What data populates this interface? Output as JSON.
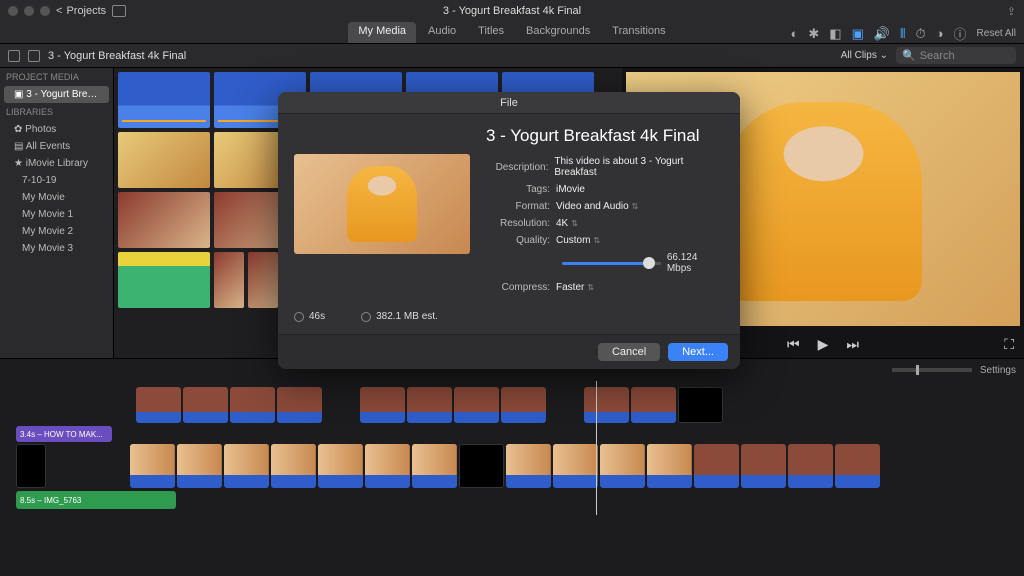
{
  "titlebar": {
    "projects": "Projects",
    "title": "3 - Yogurt Breakfast 4k Final"
  },
  "tabs": {
    "items": [
      "My Media",
      "Audio",
      "Titles",
      "Backgrounds",
      "Transitions"
    ],
    "reset": "Reset All"
  },
  "browserbar": {
    "title": "3 - Yogurt Breakfast 4k Final",
    "allclips": "All Clips",
    "search_placeholder": "Search"
  },
  "sidebar": {
    "hdr1": "Project Media",
    "project": "3 - Yogurt Breakfas...",
    "hdr2": "Libraries",
    "items": [
      "Photos",
      "All Events",
      "iMovie Library",
      "7-10-19",
      "My Movie",
      "My Movie 1",
      "My Movie 2",
      "My Movie 3"
    ]
  },
  "timeline_bar": {
    "settings": "Settings"
  },
  "timeline": {
    "title_clip": "3.4s – HOW TO MAK...",
    "audio_clip": "8.5s – IMG_5763"
  },
  "dialog": {
    "header": "File",
    "title": "3 - Yogurt Breakfast 4k Final",
    "rows": {
      "description": {
        "label": "Description:",
        "value": "This video is about 3 - Yogurt Breakfast"
      },
      "tags": {
        "label": "Tags:",
        "value": "iMovie"
      },
      "format": {
        "label": "Format:",
        "value": "Video and Audio"
      },
      "resolution": {
        "label": "Resolution:",
        "value": "4K"
      },
      "quality": {
        "label": "Quality:",
        "value": "Custom"
      },
      "compress": {
        "label": "Compress:",
        "value": "Faster"
      }
    },
    "bitrate": "66.124 Mbps",
    "duration": "46s",
    "filesize": "382.1 MB est.",
    "cancel": "Cancel",
    "next": "Next..."
  }
}
